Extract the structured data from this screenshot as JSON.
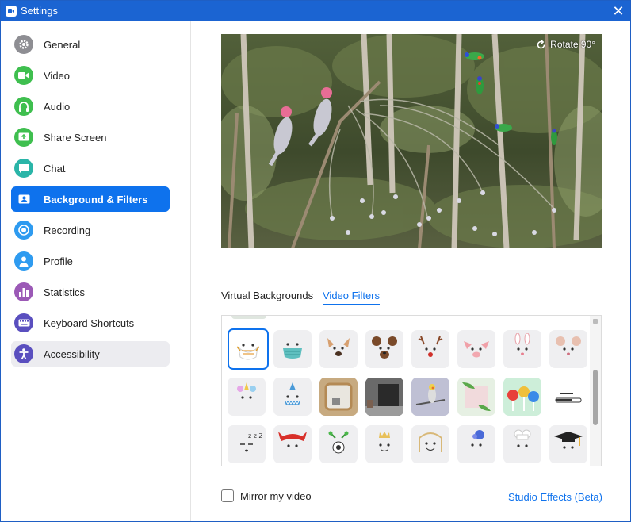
{
  "window": {
    "title": "Settings"
  },
  "sidebar": {
    "items": [
      {
        "label": "General",
        "icon": "gear-icon",
        "color": "#8e8e93"
      },
      {
        "label": "Video",
        "icon": "video-camera-icon",
        "color": "#3fbf4f"
      },
      {
        "label": "Audio",
        "icon": "headphones-icon",
        "color": "#3fbf4f"
      },
      {
        "label": "Share Screen",
        "icon": "share-screen-icon",
        "color": "#3fbf4f"
      },
      {
        "label": "Chat",
        "icon": "chat-bubble-icon",
        "color": "#2ab5a8"
      },
      {
        "label": "Background & Filters",
        "icon": "person-card-icon",
        "color": "#0e72ed",
        "active": true
      },
      {
        "label": "Recording",
        "icon": "record-icon",
        "color": "#2e9bf0"
      },
      {
        "label": "Profile",
        "icon": "person-icon",
        "color": "#2e9bf0"
      },
      {
        "label": "Statistics",
        "icon": "bar-chart-icon",
        "color": "#9b59b6"
      },
      {
        "label": "Keyboard Shortcuts",
        "icon": "keyboard-icon",
        "color": "#5a4fbf"
      },
      {
        "label": "Accessibility",
        "icon": "accessibility-icon",
        "color": "#5a4fbf"
      }
    ]
  },
  "preview": {
    "rotate_label": "Rotate 90°"
  },
  "tabs": {
    "virtual_backgrounds": "Virtual Backgrounds",
    "video_filters": "Video Filters"
  },
  "filters": [
    [
      "face-mask-white",
      "face-mask-surgical",
      "dog-face",
      "bear-face",
      "reindeer-face",
      "pig-face",
      "bunny-face",
      "mouse-face"
    ],
    [
      "unicorn-face",
      "shark-face",
      "mirror-frame",
      "tv-frame",
      "cockatiel-frame",
      "leaf-frame",
      "lollipops-frame",
      "loading-bar"
    ],
    [
      "sleepy-face",
      "red-bandana",
      "antenna-face",
      "crown-face",
      "hair-face",
      "flower-face",
      "chef-hat-face",
      "graduation-cap-face"
    ]
  ],
  "mirror": {
    "label": "Mirror my video",
    "checked": false
  },
  "studio_effects": {
    "label": "Studio Effects (Beta)"
  }
}
